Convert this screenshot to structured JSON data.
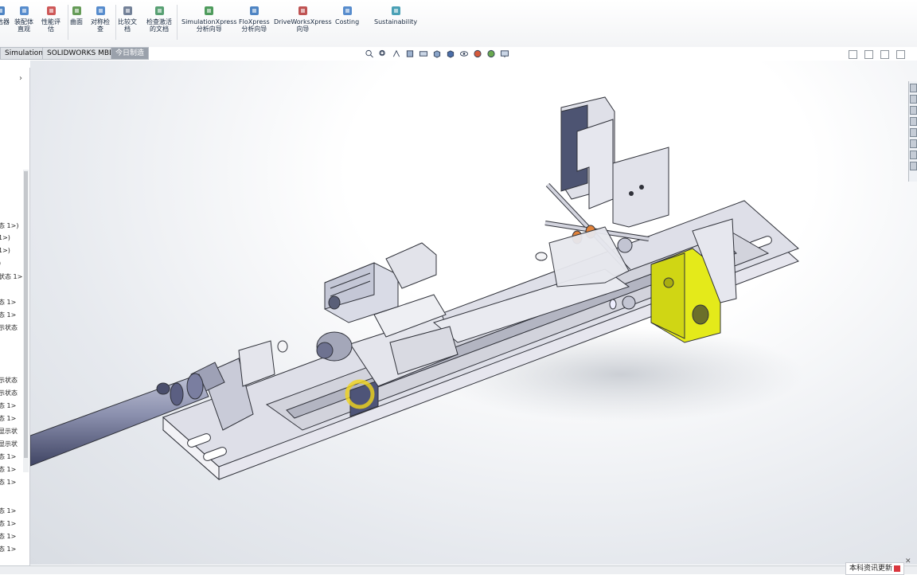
{
  "ribbon": {
    "buttons": [
      {
        "label": "评估器",
        "icon": "evaluator-icon"
      },
      {
        "label": "装配体\n直观",
        "icon": "assembly-visualization-icon"
      },
      {
        "label": "性能评\n估",
        "icon": "performance-evaluation-icon"
      },
      {
        "label": "曲面",
        "icon": "surface-icon"
      },
      {
        "label": "对称检\n查",
        "icon": "symmetry-check-icon"
      },
      {
        "label": "比较文\n档",
        "icon": "compare-documents-icon"
      },
      {
        "label": "检查激活\n的文档",
        "icon": "check-active-document-icon"
      },
      {
        "label": "SimulationXpress\n分析向导",
        "icon": "simulationxpress-icon"
      },
      {
        "label": "FloXpress\n分析向导",
        "icon": "floxpress-icon"
      },
      {
        "label": "DriveWorksXpress\n向导",
        "icon": "driveworksxpress-icon"
      },
      {
        "label": "Costing",
        "icon": "costing-icon"
      },
      {
        "label": "Sustainability",
        "icon": "sustainability-icon"
      }
    ]
  },
  "tabs": [
    {
      "label": "Simulation",
      "active": false
    },
    {
      "label": "SOLIDWORKS MBD",
      "active": false
    },
    {
      "label": "今日制造",
      "active": true
    }
  ],
  "tree": {
    "items": [
      "态 1>)",
      "1>)",
      "1>)",
      ")",
      "状态 1>",
      "态 1>",
      "态 1>",
      "示状态",
      "示状态",
      "示状态",
      "态 1>",
      "态 1>",
      "显示状",
      "显示状",
      "态 1>",
      "态 1>",
      "态 1>",
      "态 1>",
      "态 1>",
      "态 1>",
      "态 1>"
    ]
  },
  "notification": {
    "text": "本科资讯更新"
  },
  "colors": {
    "accent_yellow": "#e4ea1a",
    "part_gray": "#d7d8e0",
    "orange": "#e0823a"
  }
}
